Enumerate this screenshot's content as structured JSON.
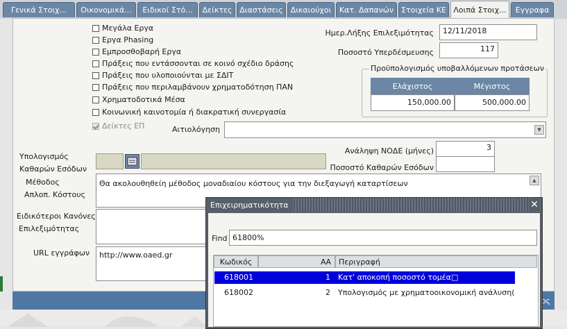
{
  "tabs": [
    {
      "label": "Γενικά Στοιχ...",
      "active": false
    },
    {
      "label": "Οικονομικά...",
      "active": false
    },
    {
      "label": "Ειδικοί Στό...",
      "active": false
    },
    {
      "label": "Δείκτες",
      "active": false
    },
    {
      "label": "Διαστάσεις",
      "active": false
    },
    {
      "label": "Δικαιούχοι",
      "active": false
    },
    {
      "label": "Κατ. Δαπανών",
      "active": false
    },
    {
      "label": "Στοιχεία ΚΕ",
      "active": false
    },
    {
      "label": "Λοιπά Στοιχ...",
      "active": true
    },
    {
      "label": "Εγγραφα",
      "active": false
    }
  ],
  "checkboxes": [
    {
      "label": "Μεγάλα Εργα",
      "checked": false,
      "disabled": false
    },
    {
      "label": "Εργα Phasing",
      "checked": false,
      "disabled": false
    },
    {
      "label": "Εμπροσθοβαρή Εργα",
      "checked": false,
      "disabled": false
    },
    {
      "label": "Πράξεις που εντάσσονται σε κοινό σχέδιο δράσης",
      "checked": false,
      "disabled": false
    },
    {
      "label": "Πράξεις που υλοποιούνται με ΣΔΙΤ",
      "checked": false,
      "disabled": false
    },
    {
      "label": "Πράξεις που περιλαμβάνουν χρηματοδότηση ΠΑΝ",
      "checked": false,
      "disabled": false
    },
    {
      "label": "Χρηματοδοτικά Μέσα",
      "checked": false,
      "disabled": false
    },
    {
      "label": "Κοινωνική καινοτομία ή διακρατική συνεργασία",
      "checked": false,
      "disabled": false
    },
    {
      "label": "Δείκτες ΕΠ",
      "checked": true,
      "disabled": true
    }
  ],
  "eligibility_end": {
    "label": "Ημερ.Λήξης Επιλεξιμότητας",
    "value": "12/11/2018"
  },
  "overcommit": {
    "label": "Ποσοστό Υπερδέσμευσης",
    "value": "117"
  },
  "budget": {
    "title": "Προϋπολογισμός υποβαλλόμενων προτάσεων",
    "min_label": "Ελάχιστος",
    "max_label": "Μέγιστος",
    "min_value": "150,000.00",
    "max_value": "500,000.00"
  },
  "justification": {
    "label": "Αιτιολόγηση",
    "value": ""
  },
  "calc_net": {
    "label1": "Υπολογισμός",
    "label2": "Καθαρών Εσόδων"
  },
  "node": {
    "label": "Ανάληψη ΝΟΔΕ (μήνες)",
    "value": "3"
  },
  "net_income_pct": {
    "label": "Ποσοστό Καθαρών Εσόδων",
    "value": ""
  },
  "method": {
    "label1": "Μέθοδος",
    "label2": "Απλοπ. Κόστους",
    "value": "Θα ακολουθηθείη μέθοδος μοναδιαίου κόστους για την διεξαγωγή καταρτίσεων"
  },
  "special_rules": {
    "label1": "Ειδικότεροι Κανόνες",
    "label2": "Επιλεξιμότητας"
  },
  "url": {
    "label": "URL εγγράφων",
    "value": "http://www.oaed.gr"
  },
  "bottom_text": "ος",
  "popup": {
    "title": "Επιχειρηματικότητα",
    "find_label": "Find",
    "find_value": "61800%",
    "columns": {
      "code": "Κωδικός",
      "aa": "ΑΑ",
      "desc": "Περιγραφή"
    },
    "rows": [
      {
        "code": "618001",
        "aa": "1",
        "desc": "Κατ' αποκοπή ποσοστό τομέα□",
        "selected": true
      },
      {
        "code": "618002",
        "aa": "2",
        "desc": "Υπολογισμός με χρηματοοικονομική ανάλυση(",
        "selected": false
      }
    ]
  }
}
